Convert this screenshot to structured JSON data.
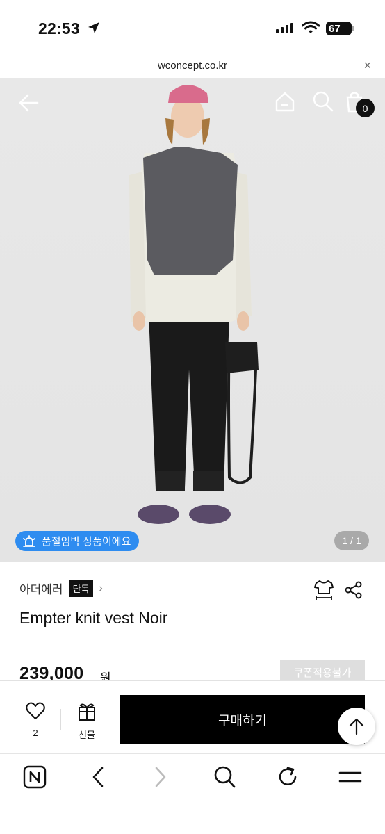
{
  "status_bar": {
    "time": "22:53",
    "battery": "67"
  },
  "browser": {
    "url": "wconcept.co.kr",
    "close": "×"
  },
  "gallery": {
    "soldout_notice": "품절임박 상품이에요",
    "page_indicator": "1 / 1",
    "cart_count": "0"
  },
  "product": {
    "brand": "아더에러",
    "badge": "단독",
    "name": "Empter knit vest Noir",
    "price": "239,000",
    "price_unit": "원",
    "coupon_label": "쿠폰적용불가"
  },
  "buybar": {
    "like_count": "2",
    "gift_label": "선물",
    "buy_label": "구매하기"
  },
  "icons": [
    "back-arrow-icon",
    "home-icon",
    "search-icon",
    "cart-icon",
    "alarm-icon",
    "size-guide-icon",
    "share-icon",
    "heart-icon",
    "gift-icon",
    "arrow-up-icon",
    "naver-icon",
    "chevron-left-icon",
    "chevron-right-icon",
    "refresh-icon",
    "menu-icon"
  ],
  "colors": {
    "accent_blue": "#2e8cf0",
    "buy_button": "#000000",
    "coupon_disabled": "#dedede"
  }
}
